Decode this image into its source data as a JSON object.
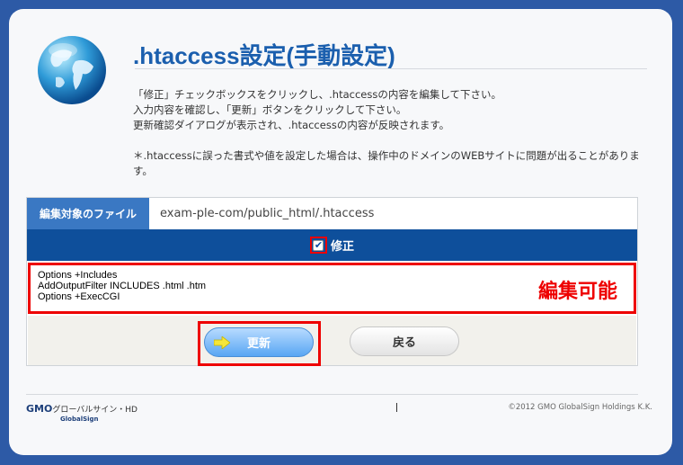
{
  "page": {
    "title": ".htaccess設定(手動設定)",
    "description": [
      "「修正」チェックボックスをクリックし、.htaccessの内容を編集して下さい。",
      "入力内容を確認し、「更新」ボタンをクリックして下さい。",
      "更新確認ダイアログが表示され、.htaccessの内容が反映されます。",
      "",
      "＊.htaccessに誤った書式や値を設定した場合は、操作中のドメインのWEBサイトに問題が出ることがあります。"
    ]
  },
  "file": {
    "label": "編集対象のファイル",
    "path": "exam-ple-com/public_html/.htaccess"
  },
  "edit": {
    "checkbox_label": "修正",
    "checked": true,
    "content": "Options +Includes\nAddOutputFilter INCLUDES .html .htm\nOptions +ExecCGI",
    "annotation": "編集可能"
  },
  "buttons": {
    "update": "更新",
    "back": "戻る"
  },
  "footer": {
    "brand": "GMO",
    "brand_sub": "グローバルサイン・HD",
    "brand_tag": "GlobalSign",
    "copyright": "©2012 GMO GlobalSign Holdings K.K."
  },
  "colors": {
    "background": "#2d5aa6",
    "title": "#1b5fae",
    "edit_bar": "#0e4f9b",
    "highlight": "#ee0000"
  },
  "icons": {
    "globe": "globe-icon",
    "arrow": "arrow-right-icon",
    "check": "checkmark-icon"
  }
}
